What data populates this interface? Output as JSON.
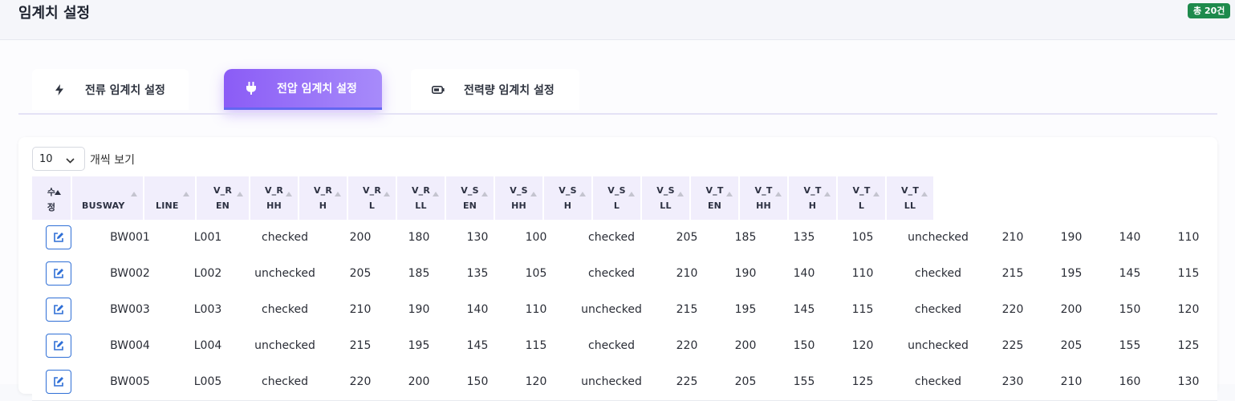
{
  "header": {
    "title": "임계치 설정",
    "count_badge": "총 20건"
  },
  "tabs": [
    {
      "label": "전류 임계치 설정",
      "icon": "bolt-icon",
      "active": false
    },
    {
      "label": "전압 임계치 설정",
      "icon": "plug-icon",
      "active": true
    },
    {
      "label": "전력량 임계치 설정",
      "icon": "battery-icon",
      "active": false
    }
  ],
  "table": {
    "length_select": {
      "value": "10",
      "suffix": "개씩 보기"
    },
    "columns": [
      {
        "l1": "수",
        "l2": "정"
      },
      {
        "l1": "",
        "l2": "BUSWAY"
      },
      {
        "l1": "",
        "l2": "LINE"
      },
      {
        "l1": "V_R",
        "l2": "EN"
      },
      {
        "l1": "V_R",
        "l2": "HH"
      },
      {
        "l1": "V_R",
        "l2": "H"
      },
      {
        "l1": "V_R",
        "l2": "L"
      },
      {
        "l1": "V_R",
        "l2": "LL"
      },
      {
        "l1": "V_S",
        "l2": "EN"
      },
      {
        "l1": "V_S",
        "l2": "HH"
      },
      {
        "l1": "V_S",
        "l2": "H"
      },
      {
        "l1": "V_S",
        "l2": "L"
      },
      {
        "l1": "V_S",
        "l2": "LL"
      },
      {
        "l1": "V_T",
        "l2": "EN"
      },
      {
        "l1": "V_T",
        "l2": "HH"
      },
      {
        "l1": "V_T",
        "l2": "H"
      },
      {
        "l1": "V_T",
        "l2": "L"
      },
      {
        "l1": "V_T",
        "l2": "LL"
      }
    ],
    "rows": [
      [
        "BW001",
        "L001",
        "checked",
        "200",
        "180",
        "130",
        "100",
        "checked",
        "205",
        "185",
        "135",
        "105",
        "unchecked",
        "210",
        "190",
        "140",
        "110"
      ],
      [
        "BW002",
        "L002",
        "unchecked",
        "205",
        "185",
        "135",
        "105",
        "checked",
        "210",
        "190",
        "140",
        "110",
        "checked",
        "215",
        "195",
        "145",
        "115"
      ],
      [
        "BW003",
        "L003",
        "checked",
        "210",
        "190",
        "140",
        "110",
        "unchecked",
        "215",
        "195",
        "145",
        "115",
        "checked",
        "220",
        "200",
        "150",
        "120"
      ],
      [
        "BW004",
        "L004",
        "unchecked",
        "215",
        "195",
        "145",
        "115",
        "checked",
        "220",
        "200",
        "150",
        "120",
        "unchecked",
        "225",
        "205",
        "155",
        "125"
      ],
      [
        "BW005",
        "L005",
        "checked",
        "220",
        "200",
        "150",
        "120",
        "unchecked",
        "225",
        "205",
        "155",
        "125",
        "checked",
        "230",
        "210",
        "160",
        "130"
      ]
    ]
  },
  "colors": {
    "accent": "#8b5cf6",
    "badge": "#1e8a4c",
    "edit": "#2f6fd6"
  }
}
